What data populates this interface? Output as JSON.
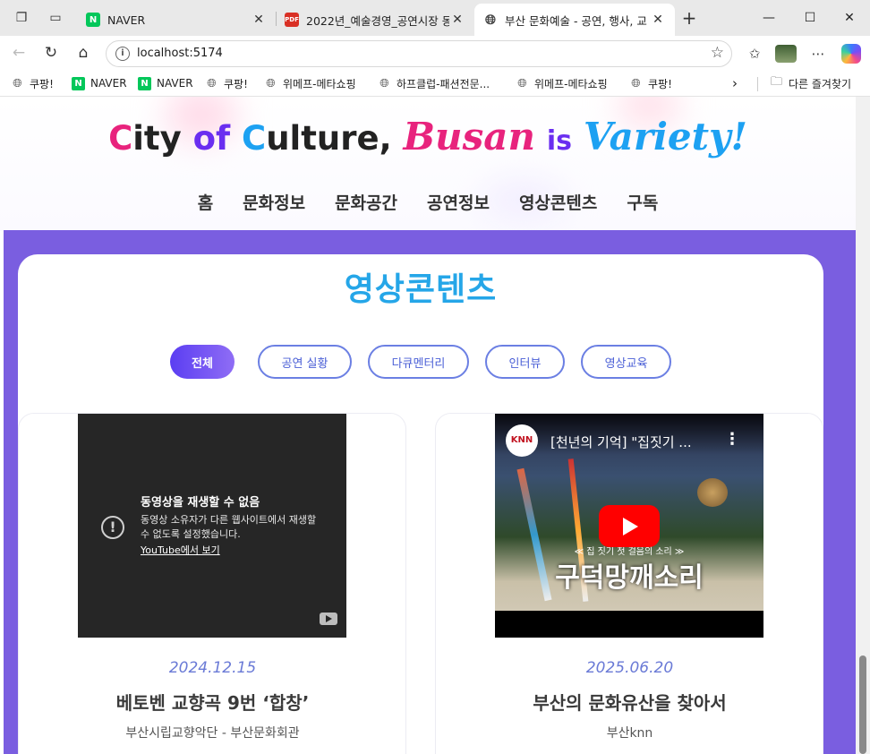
{
  "browser": {
    "tabs": [
      {
        "title": "NAVER",
        "icon": "naver-favicon",
        "active": false
      },
      {
        "title": "2022년_예술경영_공연시장 동",
        "icon": "pdf-favicon",
        "active": false
      },
      {
        "title": "부산 문화예술 - 공연, 행사, 교",
        "icon": "globe-favicon",
        "active": true
      }
    ],
    "new_tab": "+",
    "controls": {
      "minimize": "—",
      "maximize": "☐",
      "close": "✕"
    },
    "url": "localhost:5174",
    "bookmarks": [
      {
        "label": "쿠팡!",
        "icon": "globe-icon"
      },
      {
        "label": "NAVER",
        "icon": "naver-icon"
      },
      {
        "label": "NAVER",
        "icon": "naver-icon"
      },
      {
        "label": "쿠팡!",
        "icon": "globe-icon"
      },
      {
        "label": "위메프-메타쇼핑",
        "icon": "globe-icon"
      },
      {
        "label": "하프클럽-패션전문...",
        "icon": "globe-icon"
      },
      {
        "label": "위메프-메타쇼핑",
        "icon": "globe-icon"
      },
      {
        "label": "쿠팡!",
        "icon": "globe-icon"
      }
    ],
    "other_bookmarks": "다른 즐겨찾기"
  },
  "site": {
    "logo": {
      "c": "C",
      "ity": "ity",
      "of": "of",
      "C2": "C",
      "ulture": "ulture,",
      "busan": "Busan",
      "is": "is",
      "variety": "Variety!"
    },
    "nav": [
      "홈",
      "문화정보",
      "문화공간",
      "공연정보",
      "영상콘텐츠",
      "구독"
    ],
    "section_title": "영상콘텐츠",
    "filters": [
      "전체",
      "공연 실황",
      "다큐멘터리",
      "인터뷰",
      "영상교육"
    ],
    "active_filter": "전체",
    "videos": [
      {
        "error_title": "동영상을 재생할 수 없음",
        "error_body": "동영상 소유자가 다른 웹사이트에서 재생할 수 없도록 설정했습니다.",
        "error_link": "YouTube에서 보기",
        "date": "2024.12.15",
        "title": "베토벤 교향곡 9번 ‘합창’",
        "subtitle": "부산시립교향악단 - 부산문화회관"
      },
      {
        "channel": "KNN",
        "video_title": "[천년의 기억] \"집짓기 ...",
        "overlay_small": "≪ 집 짓기 첫 걸음의 소리 ≫",
        "overlay_big": "구덕망깨소리",
        "date": "2025.06.20",
        "title": "부산의 문화유산을 찾아서",
        "subtitle": "부산knn"
      }
    ]
  },
  "colors": {
    "purple": "#7a5ee0",
    "accent_blue": "#25a6e8",
    "filter_border": "#6b7fe3",
    "youtube_red": "#ff0000"
  }
}
